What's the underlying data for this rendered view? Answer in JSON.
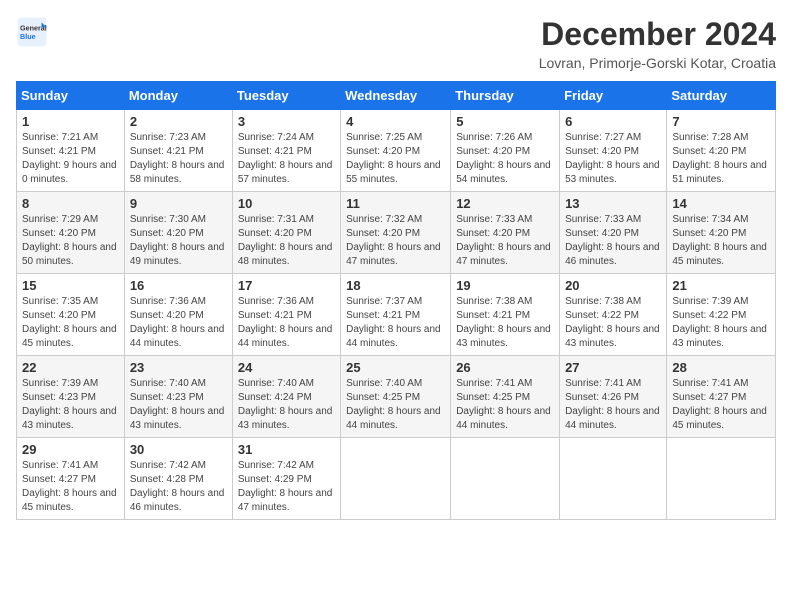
{
  "header": {
    "logo_general": "General",
    "logo_blue": "Blue",
    "month_title": "December 2024",
    "location": "Lovran, Primorje-Gorski Kotar, Croatia"
  },
  "days_of_week": [
    "Sunday",
    "Monday",
    "Tuesday",
    "Wednesday",
    "Thursday",
    "Friday",
    "Saturday"
  ],
  "weeks": [
    [
      {
        "day": "1",
        "sunrise": "Sunrise: 7:21 AM",
        "sunset": "Sunset: 4:21 PM",
        "daylight": "Daylight: 9 hours and 0 minutes."
      },
      {
        "day": "2",
        "sunrise": "Sunrise: 7:23 AM",
        "sunset": "Sunset: 4:21 PM",
        "daylight": "Daylight: 8 hours and 58 minutes."
      },
      {
        "day": "3",
        "sunrise": "Sunrise: 7:24 AM",
        "sunset": "Sunset: 4:21 PM",
        "daylight": "Daylight: 8 hours and 57 minutes."
      },
      {
        "day": "4",
        "sunrise": "Sunrise: 7:25 AM",
        "sunset": "Sunset: 4:20 PM",
        "daylight": "Daylight: 8 hours and 55 minutes."
      },
      {
        "day": "5",
        "sunrise": "Sunrise: 7:26 AM",
        "sunset": "Sunset: 4:20 PM",
        "daylight": "Daylight: 8 hours and 54 minutes."
      },
      {
        "day": "6",
        "sunrise": "Sunrise: 7:27 AM",
        "sunset": "Sunset: 4:20 PM",
        "daylight": "Daylight: 8 hours and 53 minutes."
      },
      {
        "day": "7",
        "sunrise": "Sunrise: 7:28 AM",
        "sunset": "Sunset: 4:20 PM",
        "daylight": "Daylight: 8 hours and 51 minutes."
      }
    ],
    [
      {
        "day": "8",
        "sunrise": "Sunrise: 7:29 AM",
        "sunset": "Sunset: 4:20 PM",
        "daylight": "Daylight: 8 hours and 50 minutes."
      },
      {
        "day": "9",
        "sunrise": "Sunrise: 7:30 AM",
        "sunset": "Sunset: 4:20 PM",
        "daylight": "Daylight: 8 hours and 49 minutes."
      },
      {
        "day": "10",
        "sunrise": "Sunrise: 7:31 AM",
        "sunset": "Sunset: 4:20 PM",
        "daylight": "Daylight: 8 hours and 48 minutes."
      },
      {
        "day": "11",
        "sunrise": "Sunrise: 7:32 AM",
        "sunset": "Sunset: 4:20 PM",
        "daylight": "Daylight: 8 hours and 47 minutes."
      },
      {
        "day": "12",
        "sunrise": "Sunrise: 7:33 AM",
        "sunset": "Sunset: 4:20 PM",
        "daylight": "Daylight: 8 hours and 47 minutes."
      },
      {
        "day": "13",
        "sunrise": "Sunrise: 7:33 AM",
        "sunset": "Sunset: 4:20 PM",
        "daylight": "Daylight: 8 hours and 46 minutes."
      },
      {
        "day": "14",
        "sunrise": "Sunrise: 7:34 AM",
        "sunset": "Sunset: 4:20 PM",
        "daylight": "Daylight: 8 hours and 45 minutes."
      }
    ],
    [
      {
        "day": "15",
        "sunrise": "Sunrise: 7:35 AM",
        "sunset": "Sunset: 4:20 PM",
        "daylight": "Daylight: 8 hours and 45 minutes."
      },
      {
        "day": "16",
        "sunrise": "Sunrise: 7:36 AM",
        "sunset": "Sunset: 4:20 PM",
        "daylight": "Daylight: 8 hours and 44 minutes."
      },
      {
        "day": "17",
        "sunrise": "Sunrise: 7:36 AM",
        "sunset": "Sunset: 4:21 PM",
        "daylight": "Daylight: 8 hours and 44 minutes."
      },
      {
        "day": "18",
        "sunrise": "Sunrise: 7:37 AM",
        "sunset": "Sunset: 4:21 PM",
        "daylight": "Daylight: 8 hours and 44 minutes."
      },
      {
        "day": "19",
        "sunrise": "Sunrise: 7:38 AM",
        "sunset": "Sunset: 4:21 PM",
        "daylight": "Daylight: 8 hours and 43 minutes."
      },
      {
        "day": "20",
        "sunrise": "Sunrise: 7:38 AM",
        "sunset": "Sunset: 4:22 PM",
        "daylight": "Daylight: 8 hours and 43 minutes."
      },
      {
        "day": "21",
        "sunrise": "Sunrise: 7:39 AM",
        "sunset": "Sunset: 4:22 PM",
        "daylight": "Daylight: 8 hours and 43 minutes."
      }
    ],
    [
      {
        "day": "22",
        "sunrise": "Sunrise: 7:39 AM",
        "sunset": "Sunset: 4:23 PM",
        "daylight": "Daylight: 8 hours and 43 minutes."
      },
      {
        "day": "23",
        "sunrise": "Sunrise: 7:40 AM",
        "sunset": "Sunset: 4:23 PM",
        "daylight": "Daylight: 8 hours and 43 minutes."
      },
      {
        "day": "24",
        "sunrise": "Sunrise: 7:40 AM",
        "sunset": "Sunset: 4:24 PM",
        "daylight": "Daylight: 8 hours and 43 minutes."
      },
      {
        "day": "25",
        "sunrise": "Sunrise: 7:40 AM",
        "sunset": "Sunset: 4:25 PM",
        "daylight": "Daylight: 8 hours and 44 minutes."
      },
      {
        "day": "26",
        "sunrise": "Sunrise: 7:41 AM",
        "sunset": "Sunset: 4:25 PM",
        "daylight": "Daylight: 8 hours and 44 minutes."
      },
      {
        "day": "27",
        "sunrise": "Sunrise: 7:41 AM",
        "sunset": "Sunset: 4:26 PM",
        "daylight": "Daylight: 8 hours and 44 minutes."
      },
      {
        "day": "28",
        "sunrise": "Sunrise: 7:41 AM",
        "sunset": "Sunset: 4:27 PM",
        "daylight": "Daylight: 8 hours and 45 minutes."
      }
    ],
    [
      {
        "day": "29",
        "sunrise": "Sunrise: 7:41 AM",
        "sunset": "Sunset: 4:27 PM",
        "daylight": "Daylight: 8 hours and 45 minutes."
      },
      {
        "day": "30",
        "sunrise": "Sunrise: 7:42 AM",
        "sunset": "Sunset: 4:28 PM",
        "daylight": "Daylight: 8 hours and 46 minutes."
      },
      {
        "day": "31",
        "sunrise": "Sunrise: 7:42 AM",
        "sunset": "Sunset: 4:29 PM",
        "daylight": "Daylight: 8 hours and 47 minutes."
      },
      null,
      null,
      null,
      null
    ]
  ]
}
